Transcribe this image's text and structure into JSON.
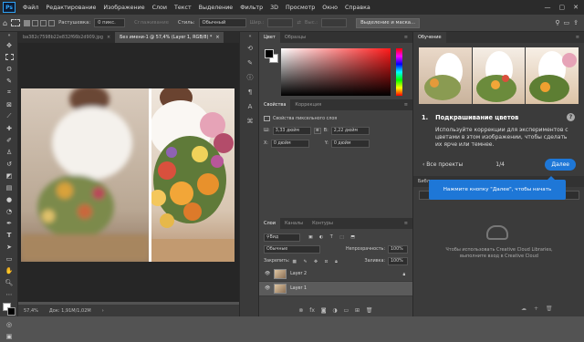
{
  "app": {
    "logo": "Ps"
  },
  "menu": [
    "Файл",
    "Редактирование",
    "Изображение",
    "Слои",
    "Текст",
    "Выделение",
    "Фильтр",
    "3D",
    "Просмотр",
    "Окно",
    "Справка"
  ],
  "options": {
    "feather_label": "Растушевка:",
    "feather_value": "0 пикс.",
    "smoothing": "Сглаживание",
    "style_label": "Стиль:",
    "style_value": "Обычный",
    "width_label": "Шир.:",
    "height_label": "Выс.:",
    "select_mask": "Выделение и маска..."
  },
  "tabs": [
    {
      "label": "ba382c7598b22e832f66b2d909.jpg",
      "close": "×"
    },
    {
      "label": "Без имени-1 @ 57,4% (Layer 1, RGB/8) *",
      "close": "×"
    }
  ],
  "status": {
    "zoom": "57,4%",
    "doc": "Док: 1,91M/1,02M"
  },
  "color_panel": {
    "tabs": [
      "Цвет",
      "Образцы"
    ]
  },
  "properties": {
    "tabs": [
      "Свойства",
      "Коррекция"
    ],
    "title": "Свойства пиксельного слоя",
    "w_label": "Ш:",
    "w_value": "3,33 дюйм",
    "h_label": "В:",
    "h_value": "2,22 дюйм",
    "x_label": "X:",
    "x_value": "0 дюйм",
    "y_label": "Y:",
    "y_value": "0 дюйм"
  },
  "layers": {
    "tabs": [
      "Слои",
      "Каналы",
      "Контуры"
    ],
    "kind": "Вид",
    "blend": "Обычные",
    "opacity_label": "Непрозрачность:",
    "opacity_value": "100%",
    "lock_label": "Закрепить:",
    "fill_label": "Заливка:",
    "fill_value": "100%",
    "items": [
      {
        "name": "Layer 2"
      },
      {
        "name": "Layer 1"
      }
    ]
  },
  "learn": {
    "tab": "Обучение",
    "step_num": "1.",
    "step_title": "Подкрашивание цветов",
    "desc": "Используйте коррекции для экспериментов с цветами в этом изображении, чтобы сделать их ярче или темнее.",
    "back": "‹ Все проекты",
    "progress": "1/4",
    "next": "Далее",
    "libraries_tab": "Библ",
    "tooltip": "Нажмите кнопку \"Далее\", чтобы начать",
    "cc_text": "Чтобы использовать Creative Cloud Libraries, выполните вход в Creative Cloud"
  }
}
